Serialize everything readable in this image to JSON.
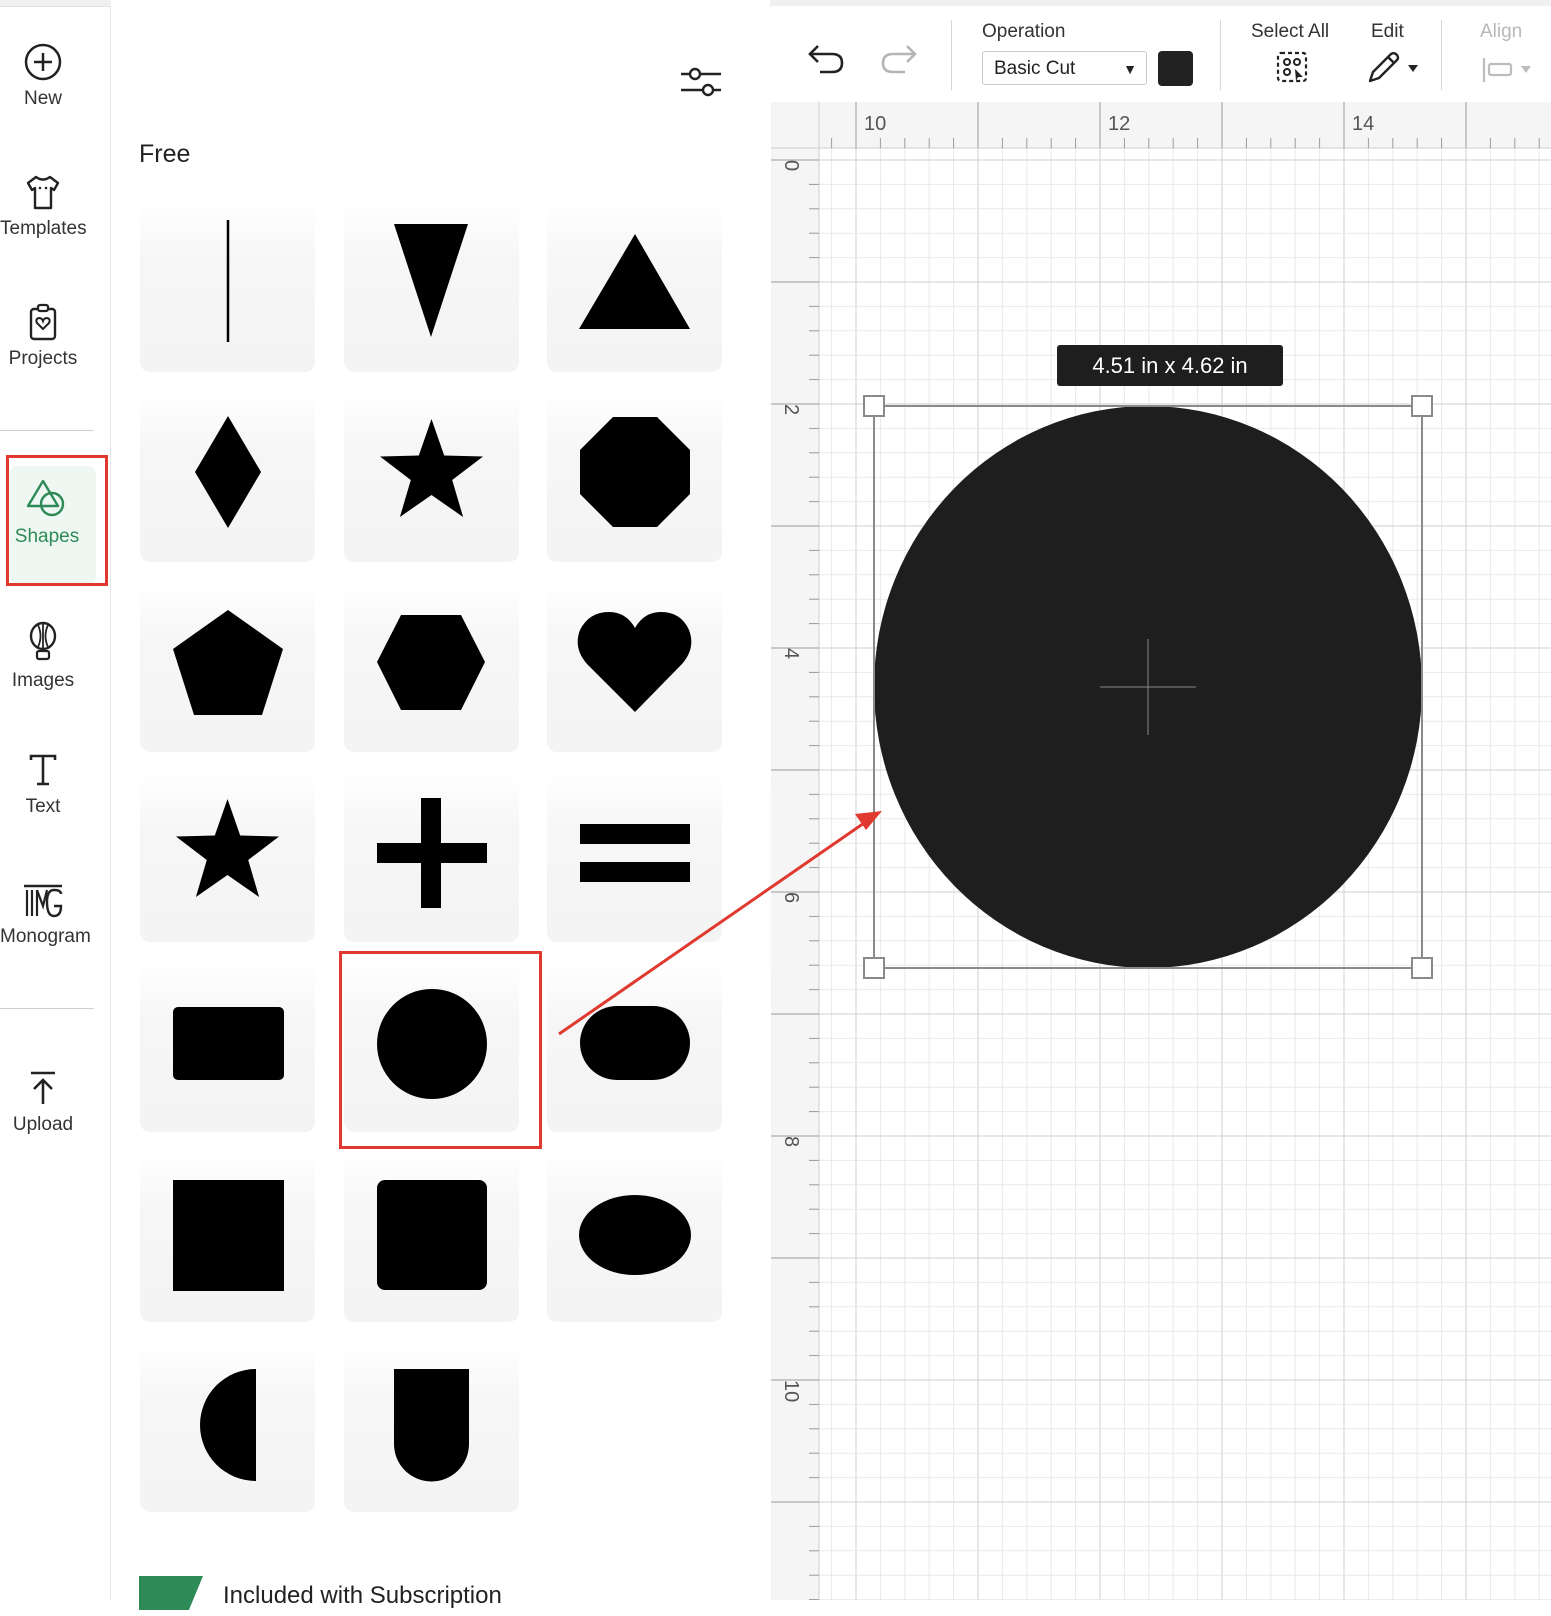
{
  "sidebar": {
    "items": [
      {
        "label": "New",
        "icon": "plus-circle-icon"
      },
      {
        "label": "Templates",
        "icon": "tshirt-icon"
      },
      {
        "label": "Projects",
        "icon": "project-heart-icon"
      },
      {
        "label": "Shapes",
        "icon": "shapes-icon",
        "active": true
      },
      {
        "label": "Images",
        "icon": "lightbulb-icon"
      },
      {
        "label": "Text",
        "icon": "text-t-icon"
      },
      {
        "label": "Monogram",
        "icon": "monogram-icon"
      },
      {
        "label": "Upload",
        "icon": "upload-icon"
      }
    ]
  },
  "panel": {
    "section_free": "Free",
    "filter_icon": "sliders-icon",
    "shapes": [
      "line",
      "triangle-down",
      "triangle",
      "diamond",
      "star",
      "octagon",
      "pentagon",
      "hexagon",
      "heart",
      "star-outline",
      "cross",
      "equals",
      "rectangle",
      "circle",
      "rounded-rectangle",
      "square",
      "rounded-square",
      "oval",
      "half-circle",
      "arch"
    ],
    "selected_shape": "circle",
    "subscription_label": "Included with Subscription"
  },
  "toolbar": {
    "operation_label": "Operation",
    "operation_value": "Basic Cut",
    "color": "#222222",
    "select_all_label": "Select All",
    "edit_label": "Edit",
    "align_label": "Align"
  },
  "canvas": {
    "ruler_top": [
      "10",
      "12",
      "14"
    ],
    "ruler_left": [
      "0",
      "2",
      "4",
      "6",
      "8",
      "10"
    ],
    "dimensions": "4.51  in x 4.62  in",
    "shape_fill": "#1e1e1e"
  },
  "annotation_color": "#e0392f",
  "accent_color": "#2e8b57"
}
